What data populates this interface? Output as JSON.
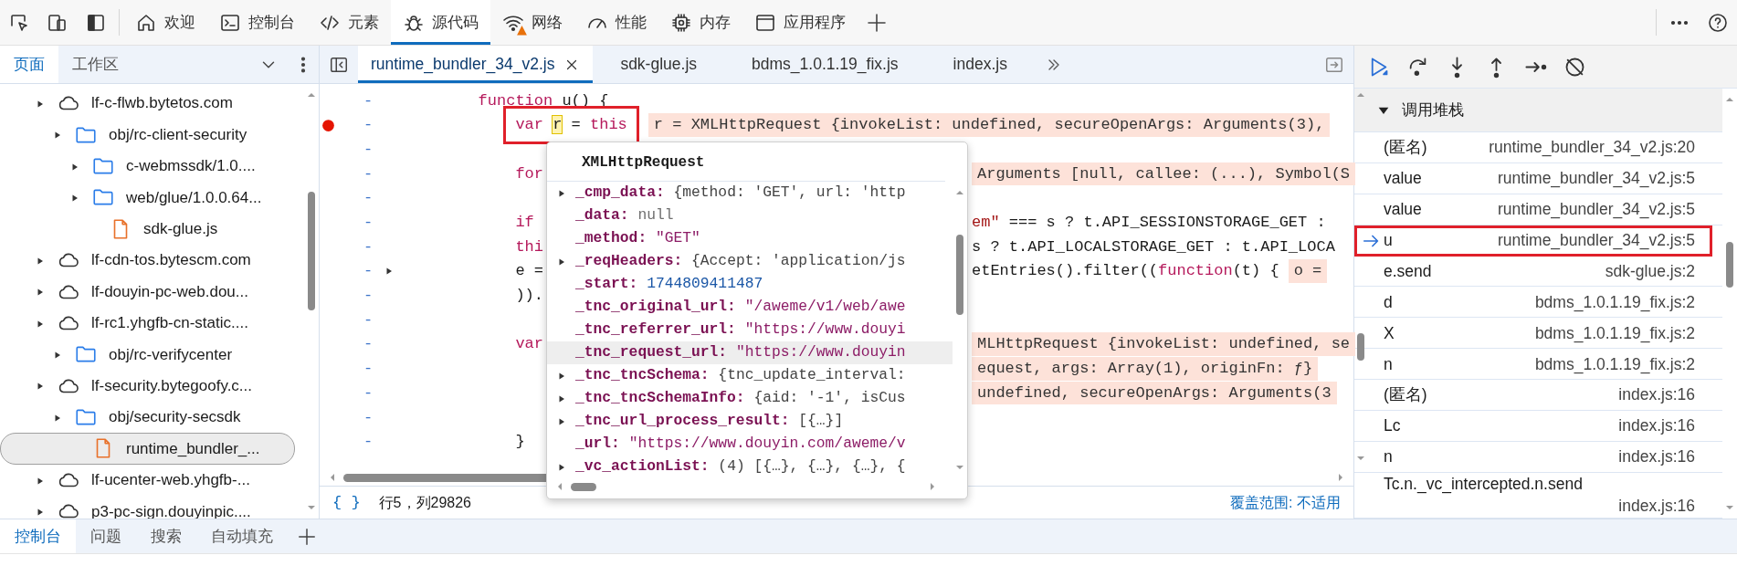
{
  "main_tabs": [
    {
      "kind": "home",
      "label": "欢迎",
      "selected": false,
      "warning": false
    },
    {
      "kind": "terminal",
      "label": "控制台",
      "selected": false,
      "warning": false
    },
    {
      "kind": "code",
      "label": "元素",
      "selected": false,
      "warning": false
    },
    {
      "kind": "bug",
      "label": "源代码",
      "selected": true,
      "warning": false
    },
    {
      "kind": "wifi",
      "label": "网络",
      "selected": false,
      "warning": true
    },
    {
      "kind": "gauge",
      "label": "性能",
      "selected": false,
      "warning": false
    },
    {
      "kind": "chip",
      "label": "内存",
      "selected": false,
      "warning": false
    },
    {
      "kind": "window",
      "label": "应用程序",
      "selected": false,
      "warning": false
    }
  ],
  "sidebar": {
    "tabs": [
      {
        "label": "页面",
        "selected": true
      },
      {
        "label": "工作区",
        "selected": false
      }
    ],
    "tree": [
      {
        "kind": "domain",
        "label": "lf-c-flwb.bytetos.com",
        "selected": false,
        "children": [
          {
            "kind": "folder",
            "label": "obj/rc-client-security",
            "selected": false,
            "children": [
              {
                "kind": "folder",
                "label": "c-webmssdk/1.0....",
                "selected": false
              },
              {
                "kind": "folder",
                "label": "web/glue/1.0.0.64...",
                "selected": false,
                "children": [
                  {
                    "kind": "file",
                    "label": "sdk-glue.js",
                    "selected": false
                  }
                ]
              }
            ]
          }
        ]
      },
      {
        "kind": "domain",
        "label": "lf-cdn-tos.bytescm.com",
        "selected": false
      },
      {
        "kind": "domain",
        "label": "lf-douyin-pc-web.dou...",
        "selected": false
      },
      {
        "kind": "domain",
        "label": "lf-rc1.yhgfb-cn-static....",
        "selected": false,
        "children": [
          {
            "kind": "folder",
            "label": "obj/rc-verifycenter",
            "selected": false
          }
        ]
      },
      {
        "kind": "domain",
        "label": "lf-security.bytegoofy.c...",
        "selected": false,
        "children": [
          {
            "kind": "folder",
            "label": "obj/security-secsdk",
            "selected": false,
            "children": [
              {
                "kind": "file",
                "label": "runtime_bundler_...",
                "selected": true
              }
            ]
          }
        ]
      },
      {
        "kind": "domain",
        "label": "lf-ucenter-web.yhgfb-...",
        "selected": false
      },
      {
        "kind": "domain",
        "label": "p3-pc-sign.douyinpic....",
        "selected": false
      }
    ]
  },
  "editor": {
    "tabs": [
      {
        "label": "runtime_bundler_34_v2.js",
        "selected": true,
        "closable": true
      },
      {
        "label": "sdk-glue.js",
        "selected": false,
        "closable": false
      },
      {
        "label": "bdms_1.0.1.19_fix.js",
        "selected": false,
        "closable": false
      },
      {
        "label": "index.js",
        "selected": false,
        "closable": false
      }
    ],
    "lines": [
      {
        "marker": "-",
        "kind": "function",
        "breakpoint": false,
        "boxed": false,
        "expandable": false,
        "tokens": [
          {
            "text": "function",
            "kind": "keyword"
          },
          {
            "text": " u() {",
            "kind": "plain"
          }
        ]
      },
      {
        "marker": "-",
        "kind": "open",
        "breakpoint": true,
        "boxed": true,
        "expandable": false,
        "tokens": [
          {
            "text": "var ",
            "kind": "keyword"
          },
          {
            "text": "r",
            "kind": "hovered"
          },
          {
            "text": " = ",
            "kind": "plain"
          },
          {
            "text": "this",
            "kind": "keyword"
          }
        ],
        "value": "r = XMLHttpRequest {invokeList: undefined, secureOpenArgs: Arguments(3),"
      },
      {
        "marker": "-",
        "kind": "covered",
        "breakpoint": false,
        "boxed": false,
        "expandable": false
      },
      {
        "marker": "-",
        "kind": "covered",
        "breakpoint": false,
        "boxed": false,
        "expandable": false,
        "tokens": [
          {
            "text": "for",
            "kind": "keyword"
          }
        ],
        "value": "Arguments [null, callee: (...), Symbol(S"
      },
      {
        "marker": "-",
        "kind": "covered",
        "breakpoint": false,
        "boxed": false,
        "expandable": false
      },
      {
        "marker": "-",
        "kind": "covered",
        "breakpoint": false,
        "boxed": false,
        "expandable": false,
        "tokens": [
          {
            "text": "if",
            "kind": "keyword"
          }
        ],
        "rest": [
          {
            "text": "em\"",
            "kind": "string"
          },
          {
            "text": " === s ? t.API_SESSIONSTORAGE_GET :",
            "kind": "plain"
          }
        ]
      },
      {
        "marker": "-",
        "kind": "covered",
        "breakpoint": false,
        "boxed": false,
        "expandable": false,
        "tokens": [
          {
            "text": "thi",
            "kind": "keyword"
          }
        ],
        "rest": [
          {
            "text": "s ? t.API_LOCALSTORAGE_GET : t.API_LOCA",
            "kind": "plain"
          }
        ]
      },
      {
        "marker": "-",
        "kind": "covered",
        "breakpoint": false,
        "boxed": false,
        "expandable": true,
        "tokens": [
          {
            "text": "e =",
            "kind": "plain"
          }
        ],
        "rest": [
          {
            "text": "etEntries().filter((",
            "kind": "plain"
          },
          {
            "text": "function",
            "kind": "keyword"
          },
          {
            "text": "(t) {",
            "kind": "plain"
          }
        ],
        "value": "o ="
      },
      {
        "marker": "-",
        "kind": "covered",
        "breakpoint": false,
        "boxed": false,
        "expandable": false,
        "tokens": [
          {
            "text": ")).",
            "kind": "plain"
          }
        ]
      },
      {
        "marker": "-",
        "kind": "covered",
        "breakpoint": false,
        "boxed": false,
        "expandable": false
      },
      {
        "marker": "-",
        "kind": "covered",
        "breakpoint": false,
        "boxed": false,
        "expandable": false,
        "tokens": [
          {
            "text": "var",
            "kind": "keyword"
          }
        ],
        "value": "MLHttpRequest {invokeList: undefined, se"
      },
      {
        "marker": "-",
        "kind": "covered",
        "breakpoint": false,
        "boxed": false,
        "expandable": false,
        "value": "equest, args: Array(1), originFn: ƒ}"
      },
      {
        "marker": "-",
        "kind": "covered",
        "breakpoint": false,
        "boxed": false,
        "expandable": false,
        "value": "undefined, secureOpenArgs: Arguments(3"
      },
      {
        "marker": "-",
        "kind": "covered",
        "breakpoint": false,
        "boxed": false,
        "expandable": false
      },
      {
        "marker": "-",
        "kind": "covered",
        "breakpoint": false,
        "boxed": false,
        "expandable": false,
        "tokens": [
          {
            "text": "}",
            "kind": "plain"
          }
        ]
      }
    ],
    "tooltip": {
      "title": "XMLHttpRequest",
      "properties": [
        {
          "key": "_cmp_data:",
          "value": "{method: 'GET', url: 'http",
          "kind": "object",
          "expandable": true,
          "selected": false
        },
        {
          "key": "_data:",
          "value": "null",
          "kind": "null",
          "expandable": false,
          "selected": false
        },
        {
          "key": "_method:",
          "value": "\"GET\"",
          "kind": "string",
          "expandable": false,
          "selected": false
        },
        {
          "key": "_reqHeaders:",
          "value": "{Accept: 'application/js",
          "kind": "object",
          "expandable": true,
          "selected": false
        },
        {
          "key": "_start:",
          "value": "1744809411487",
          "kind": "number",
          "expandable": false,
          "selected": false
        },
        {
          "key": "_tnc_original_url:",
          "value": "\"/aweme/v1/web/awe",
          "kind": "string",
          "expandable": false,
          "selected": false
        },
        {
          "key": "_tnc_referrer_url:",
          "value": "\"https://www.douyi",
          "kind": "string",
          "expandable": false,
          "selected": false
        },
        {
          "key": "_tnc_request_url:",
          "value": "\"https://www.douyin",
          "kind": "string",
          "expandable": false,
          "selected": true
        },
        {
          "key": "_tnc_tncSchema:",
          "value": "{tnc_update_interval:",
          "kind": "object",
          "expandable": true,
          "selected": false
        },
        {
          "key": "_tnc_tncSchemaInfo:",
          "value": "{aid: '-1', isCus",
          "kind": "object",
          "expandable": true,
          "selected": false
        },
        {
          "key": "_tnc_url_process_result:",
          "value": "[{…}]",
          "kind": "object",
          "expandable": true,
          "selected": false
        },
        {
          "key": "_url:",
          "value": "\"https://www.douyin.com/aweme/v",
          "kind": "string",
          "expandable": false,
          "selected": false
        },
        {
          "key": "_vc_actionList:",
          "value": "(4) [{…}, {…}, {…}, {",
          "kind": "object",
          "expandable": true,
          "selected": false
        }
      ]
    },
    "status": {
      "format": "{ }",
      "position": "行5，列29826",
      "coverage": "覆盖范围: 不适用"
    }
  },
  "call_stack": {
    "title": "调用堆栈",
    "expanded": true,
    "frames": [
      {
        "name": "(匿名)",
        "location": "runtime_bundler_34_v2.js:20",
        "selected": false,
        "boxed": false
      },
      {
        "name": "value",
        "location": "runtime_bundler_34_v2.js:5",
        "selected": false,
        "boxed": false
      },
      {
        "name": "value",
        "location": "runtime_bundler_34_v2.js:5",
        "selected": false,
        "boxed": false
      },
      {
        "name": "u",
        "location": "runtime_bundler_34_v2.js:5",
        "selected": true,
        "boxed": true
      },
      {
        "name": "e.send",
        "location": "sdk-glue.js:2",
        "selected": false,
        "boxed": false
      },
      {
        "name": "d",
        "location": "bdms_1.0.1.19_fix.js:2",
        "selected": false,
        "boxed": false
      },
      {
        "name": "X",
        "location": "bdms_1.0.1.19_fix.js:2",
        "selected": false,
        "boxed": false
      },
      {
        "name": "n",
        "location": "bdms_1.0.1.19_fix.js:2",
        "selected": false,
        "boxed": false
      },
      {
        "name": "(匿名)",
        "location": "index.js:16",
        "selected": false,
        "boxed": false
      },
      {
        "name": "Lc",
        "location": "index.js:16",
        "selected": false,
        "boxed": false
      },
      {
        "name": "n",
        "location": "index.js:16",
        "selected": false,
        "boxed": false
      },
      {
        "name": "Tc.n._vc_intercepted.n.send",
        "location": "index.js:16",
        "selected": false,
        "boxed": false
      }
    ]
  },
  "drawer_tabs": [
    {
      "label": "控制台",
      "selected": true
    },
    {
      "label": "问题",
      "selected": false
    },
    {
      "label": "搜索",
      "selected": false
    },
    {
      "label": "自动填充",
      "selected": false
    }
  ]
}
